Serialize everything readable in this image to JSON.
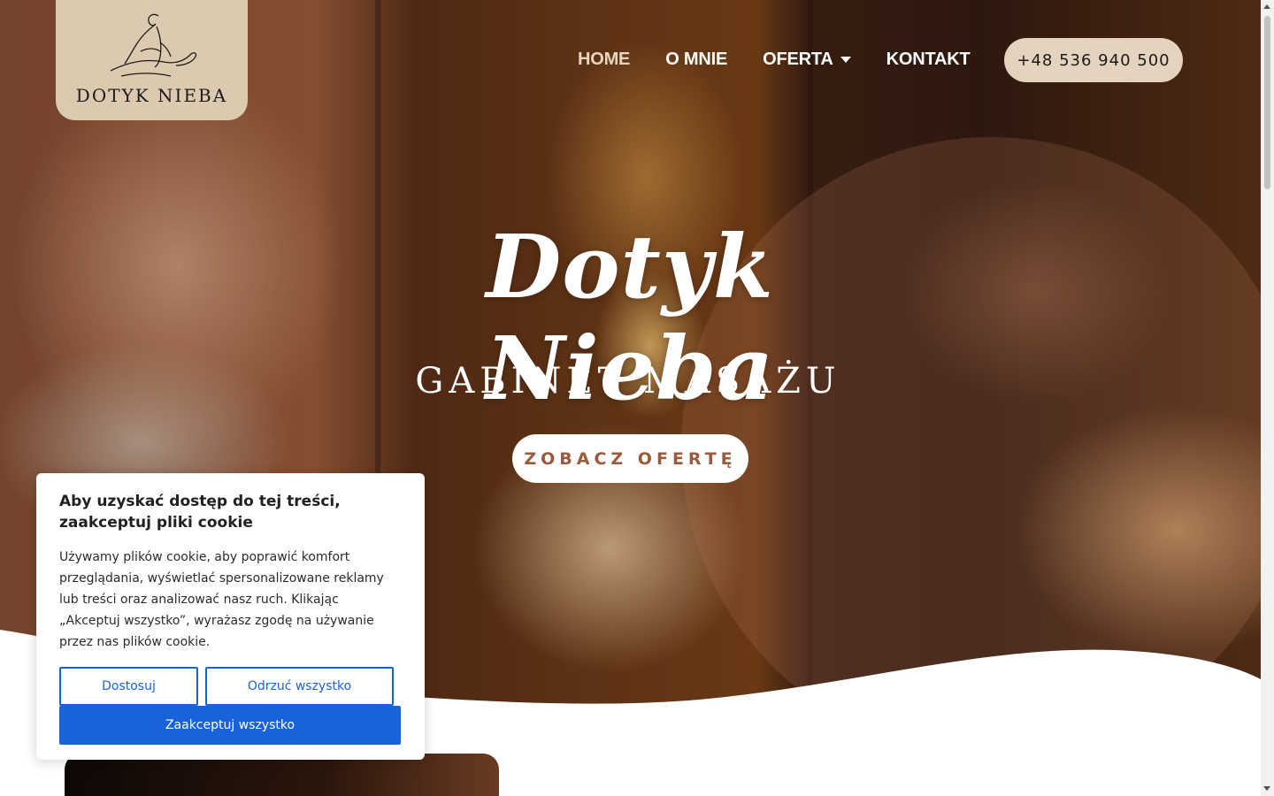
{
  "logo": {
    "text": "DOTYK NIEBA"
  },
  "nav": {
    "items": [
      {
        "label": "HOME",
        "active": true
      },
      {
        "label": "O MNIE",
        "active": false
      },
      {
        "label": "OFERTA",
        "active": false,
        "has_dropdown": true
      },
      {
        "label": "KONTAKT",
        "active": false
      }
    ],
    "phone": "+48 536 940 500"
  },
  "hero": {
    "title": "Dotyk Nieba",
    "subtitle": "GABINET MASAŻU",
    "cta_label": "ZOBACZ OFERTĘ"
  },
  "cookie_banner": {
    "title": "Aby uzyskać dostęp do tej treści, zaakceptuj pliki cookie",
    "body": "Używamy plików cookie, aby poprawić komfort przeglądania, wyświetlać spersonalizowane reklamy lub treści oraz analizować nasz ruch. Klikając „Akceptuj wszystko”, wyrażasz zgodę na używanie przez nas plików cookie.",
    "customize_label": "Dostosuj",
    "reject_label": "Odrzuć wszystko",
    "accept_label": "Zaakceptuj wszystko"
  },
  "colors": {
    "logo_bg": "#dccab0",
    "phone_bg": "#e4d4bf",
    "cta_text": "#9a5a3c",
    "cookie_primary": "#1863dc",
    "nav_active": "#e8d7be"
  },
  "icons": [
    "logo-massage-figure-icon",
    "chevron-down-icon"
  ]
}
